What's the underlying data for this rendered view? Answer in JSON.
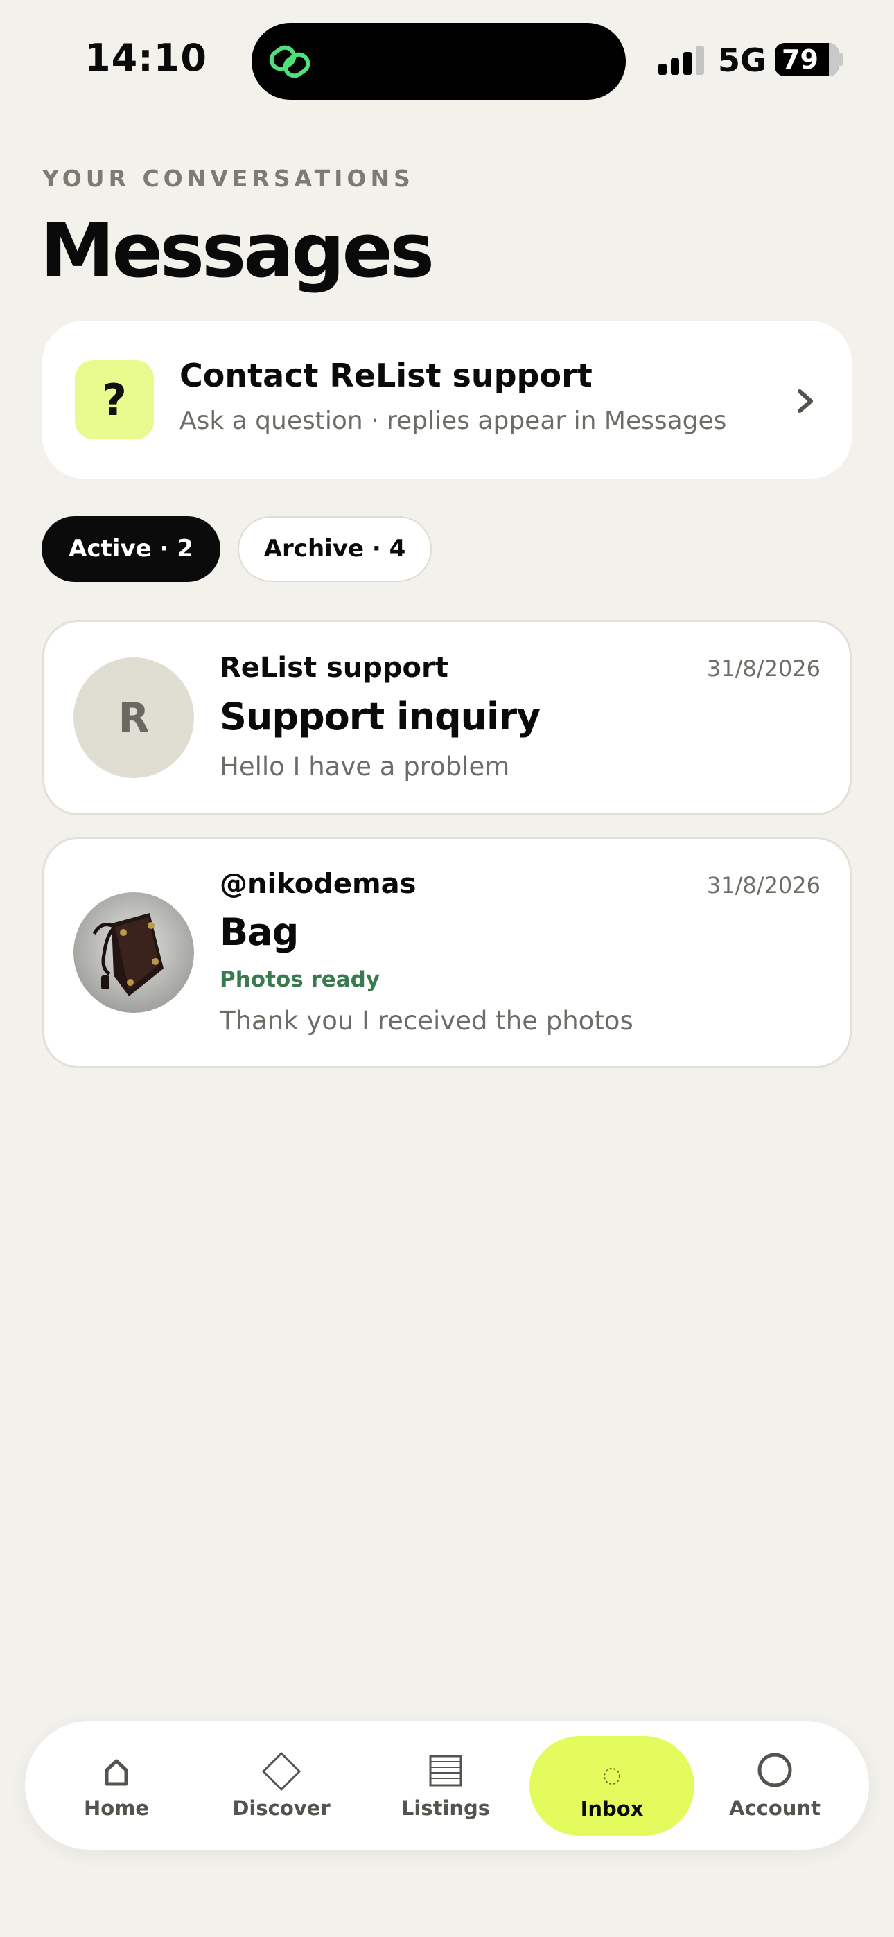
{
  "status_bar": {
    "time": "14:10",
    "network": "5G",
    "battery": "79"
  },
  "header": {
    "eyebrow": "YOUR CONVERSATIONS",
    "title": "Messages"
  },
  "support_card": {
    "icon_glyph": "?",
    "title": "Contact ReList support",
    "subtitle": "Ask a question · replies appear in Messages"
  },
  "filters": {
    "active_label": "Active · 2",
    "archive_label": "Archive · 4"
  },
  "conversations": [
    {
      "avatar_letter": "R",
      "name": "ReList support",
      "date": "31/8/2026",
      "subject": "Support inquiry",
      "preview": "Hello I have a problem"
    },
    {
      "avatar_icon": "bag-photo",
      "name": "@nikodemas",
      "date": "31/8/2026",
      "subject": "Bag",
      "status": "Photos ready",
      "preview": "Thank you I received the photos"
    }
  ],
  "tab_bar": {
    "items": [
      {
        "label": "Home",
        "icon": "home-icon"
      },
      {
        "label": "Discover",
        "icon": "diamond-icon"
      },
      {
        "label": "Listings",
        "icon": "list-icon"
      },
      {
        "label": "Inbox",
        "icon": "inbox-icon",
        "selected": true
      },
      {
        "label": "Account",
        "icon": "account-icon"
      }
    ]
  },
  "colors": {
    "background": "#f2f1ec",
    "accent": "#e3fb5d",
    "support_icon_bg": "#e9fb8f",
    "status_green": "#3a7a4f"
  }
}
